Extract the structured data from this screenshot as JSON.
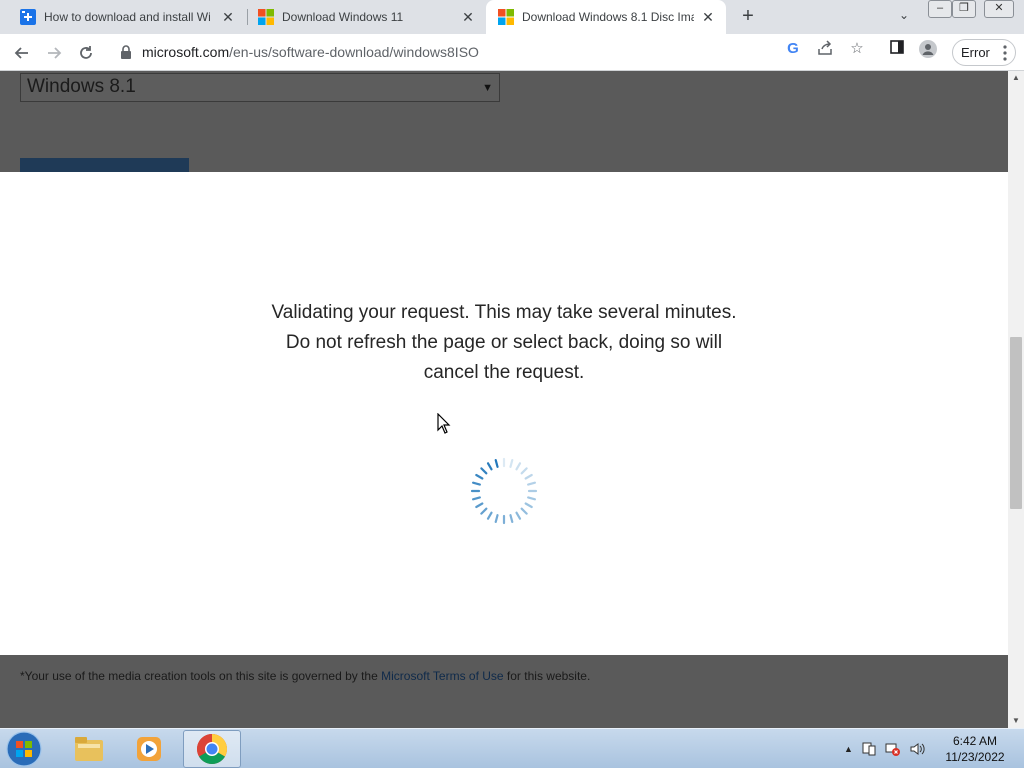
{
  "browser": {
    "tabs": [
      {
        "title": "How to download and install Wi",
        "favicon": "plus-page-favicon",
        "active": false
      },
      {
        "title": "Download Windows 11",
        "favicon": "microsoft-logo",
        "active": false
      },
      {
        "title": "Download Windows 8.1 Disc Ima",
        "favicon": "microsoft-logo",
        "active": true
      }
    ],
    "url_host": "microsoft.com",
    "url_path": "/en-us/software-download/windows8ISO",
    "profile_status": "Error"
  },
  "page": {
    "edition_select": {
      "selected": "Windows 8.1"
    },
    "validation_message": {
      "line1": "Validating your request. This may take several minutes.",
      "line2": "Do not refresh the page or select back, doing so will",
      "line3": "cancel the request."
    },
    "footer": {
      "prefix": "*Your use of the media creation tools on this site is governed by the ",
      "link": "Microsoft Terms of Use",
      "suffix": " for this website."
    }
  },
  "taskbar": {
    "apps": [
      "windows-explorer",
      "windows-media-player",
      "google-chrome"
    ],
    "clock": {
      "time": "6:42 AM",
      "date": "11/23/2022"
    }
  },
  "colors": {
    "overlay_gray": "#5a5a5a",
    "spinner_blue": "#1a73b8",
    "link_navy": "#0f2a4a"
  }
}
